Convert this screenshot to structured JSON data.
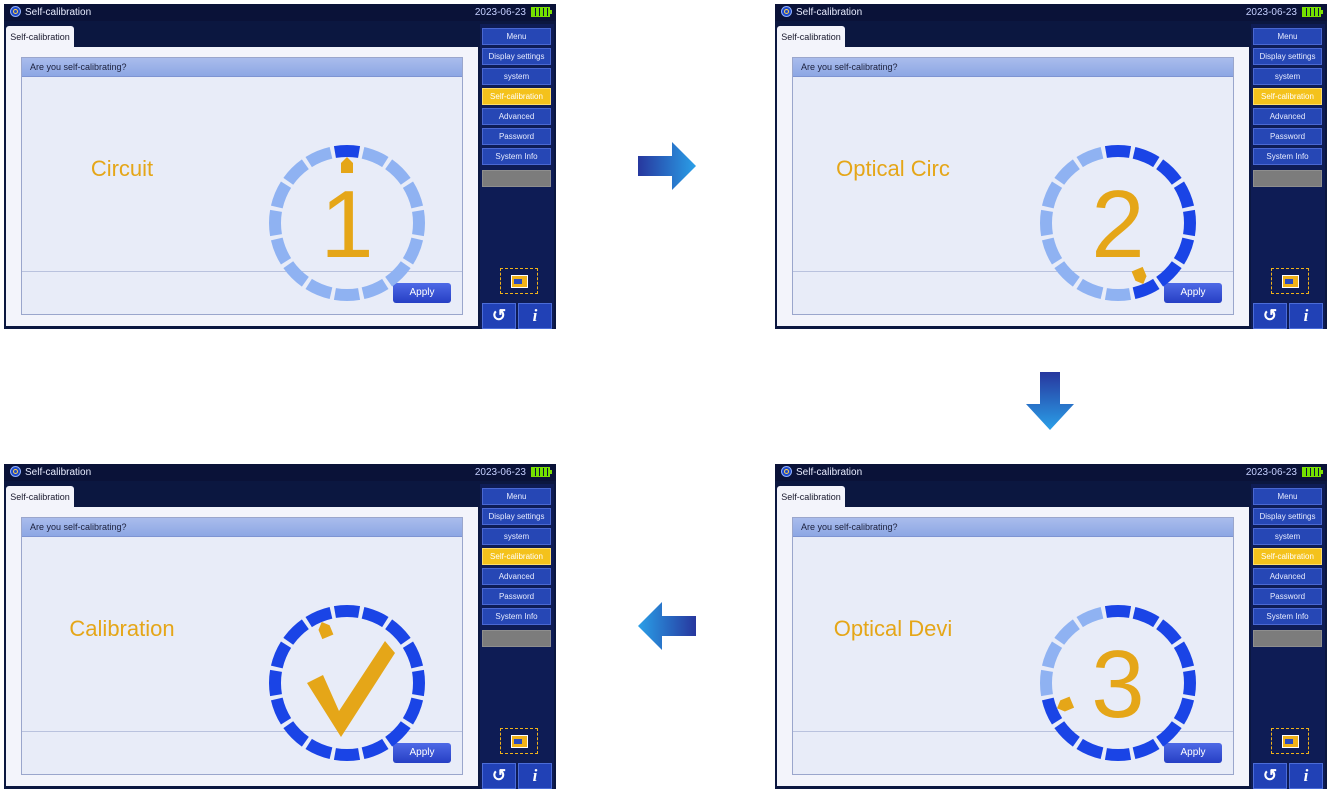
{
  "window": {
    "title": "Self-calibration",
    "date": "2023-06-23",
    "tab_label": "Self-calibration",
    "question": "Are you self-calibrating?",
    "apply_label": "Apply",
    "back_glyph": "↺",
    "info_glyph": "i"
  },
  "sidebar": {
    "items": [
      {
        "label": "Menu"
      },
      {
        "label": "Display settings"
      },
      {
        "label": "system"
      },
      {
        "label": "Self-calibration",
        "active": true
      },
      {
        "label": "Advanced"
      },
      {
        "label": "Password"
      },
      {
        "label": "System Info"
      },
      {
        "label": ""
      }
    ]
  },
  "steps": [
    {
      "label": "Circuit",
      "number": "1",
      "progress_segments": 1,
      "total_segments": 16
    },
    {
      "label": "Optical Circ",
      "number": "2",
      "progress_segments": 8,
      "total_segments": 16
    },
    {
      "label": "Optical Devi",
      "number": "3",
      "progress_segments": 12,
      "total_segments": 16
    },
    {
      "label": "Calibration",
      "number": "check",
      "progress_segments": 16,
      "total_segments": 16
    }
  ],
  "colors": {
    "accent_orange": "#e5a618",
    "ring_done": "#1a44e6",
    "ring_pending": "#8fb2f2",
    "sidebar_active": "#f4c21c",
    "arrow_blue": "#1f5fd6"
  },
  "icons": {
    "flow_arrows": [
      "arrow-right-icon",
      "arrow-down-icon",
      "arrow-left-icon"
    ]
  }
}
